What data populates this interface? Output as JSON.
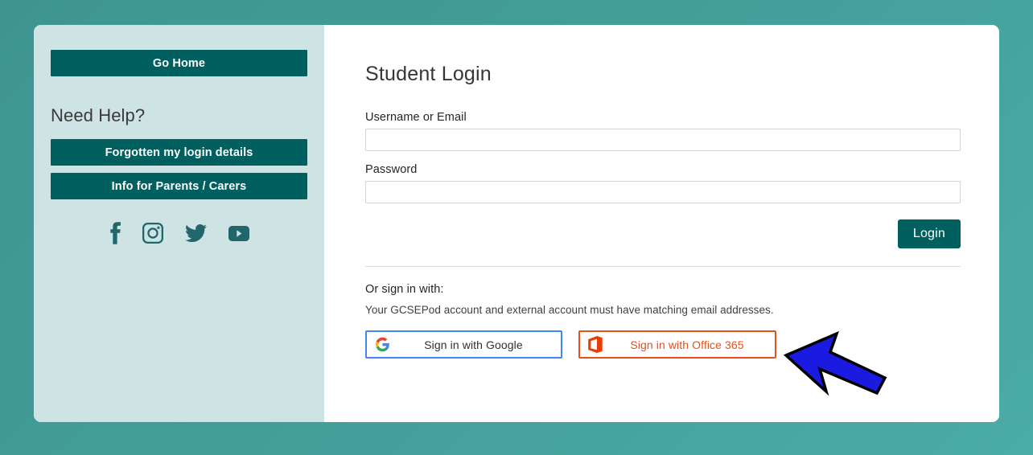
{
  "page": {
    "background_color": "#44a09c",
    "card_background": "#ffffff"
  },
  "sidebar": {
    "background_color": "#cde3e4",
    "button_color": "#00605f",
    "go_home_label": "Go Home",
    "need_help_heading": "Need Help?",
    "forgotten_label": "Forgotten my login details",
    "parents_label": "Info for Parents / Carers",
    "social": [
      {
        "name": "facebook-icon",
        "label": "Facebook"
      },
      {
        "name": "instagram-icon",
        "label": "Instagram"
      },
      {
        "name": "twitter-icon",
        "label": "Twitter"
      },
      {
        "name": "youtube-icon",
        "label": "YouTube"
      }
    ]
  },
  "main": {
    "title": "Student Login",
    "username_label": "Username or Email",
    "username_value": "",
    "username_placeholder": "",
    "password_label": "Password",
    "password_value": "",
    "password_placeholder": "",
    "login_label": "Login",
    "or_sign_in_label": "Or sign in with:",
    "matching_note": "Your GCSEPod account and external account must have matching email addresses.",
    "google_label": "Sign in with Google",
    "google_border_color": "#4285f4",
    "office_label": "Sign in with Office 365",
    "office_border_color": "#e8501c",
    "office_text_color": "#e8501c"
  },
  "annotation": {
    "arrow_name": "left-pointing-arrow",
    "fill_color": "#1a1ae0",
    "stroke_color": "#000000",
    "points_to": "Sign in with Office 365"
  }
}
